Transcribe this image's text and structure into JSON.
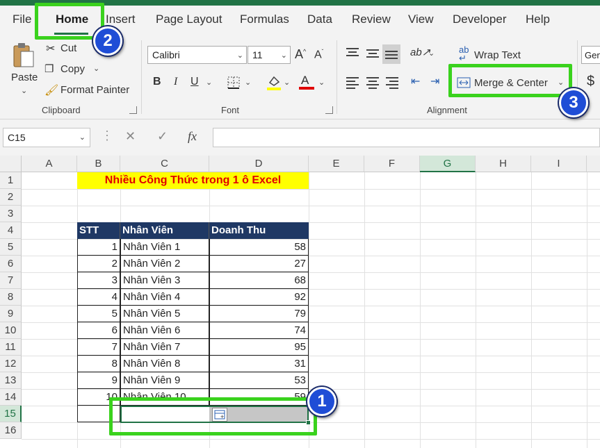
{
  "tabs": [
    "File",
    "Home",
    "Insert",
    "Page Layout",
    "Formulas",
    "Data",
    "Review",
    "View",
    "Developer",
    "Help"
  ],
  "ribbon": {
    "clipboard": {
      "paste": "Paste",
      "cut": "Cut",
      "copy": "Copy",
      "format_painter": "Format Painter",
      "label": "Clipboard"
    },
    "font": {
      "family": "Calibri",
      "size": "11",
      "bold": "B",
      "italic": "I",
      "underline": "U",
      "font_color_glyph": "A",
      "label": "Font"
    },
    "alignment": {
      "wrap_text": "Wrap Text",
      "merge_center": "Merge & Center",
      "label": "Alignment"
    },
    "number": {
      "format_partial": "Gen",
      "currency_glyph": "$"
    }
  },
  "formula_bar": {
    "name_box": "C15",
    "fx": "fx",
    "formula": ""
  },
  "sheet": {
    "columns": [
      "A",
      "B",
      "C",
      "D",
      "E",
      "F",
      "G",
      "H",
      "I"
    ],
    "rows": [
      "1",
      "2",
      "3",
      "4",
      "5",
      "6",
      "7",
      "8",
      "9",
      "10",
      "11",
      "12",
      "13",
      "14",
      "15",
      "16"
    ],
    "title": "Nhiều Công Thức trong 1 ô Excel",
    "headers": [
      "STT",
      "Nhân Viên",
      "Doanh Thu"
    ],
    "data": [
      [
        "1",
        "Nhân Viên 1",
        "58"
      ],
      [
        "2",
        "Nhân Viên 2",
        "27"
      ],
      [
        "3",
        "Nhân Viên 3",
        "68"
      ],
      [
        "4",
        "Nhân Viên 4",
        "92"
      ],
      [
        "5",
        "Nhân Viên 5",
        "79"
      ],
      [
        "6",
        "Nhân Viên 6",
        "74"
      ],
      [
        "7",
        "Nhân Viên 7",
        "95"
      ],
      [
        "8",
        "Nhân Viên 8",
        "31"
      ],
      [
        "9",
        "Nhân Viên 9",
        "53"
      ],
      [
        "10",
        "Nhân Viên 10",
        "59"
      ]
    ]
  },
  "callouts": [
    "1",
    "2",
    "3"
  ],
  "colors": {
    "excel_green": "#217346",
    "highlight": "#3ad21d",
    "header_fill": "#1f3864",
    "title_fill": "#ffff00",
    "title_text": "#e00000",
    "badge": "#1f4dd6"
  }
}
